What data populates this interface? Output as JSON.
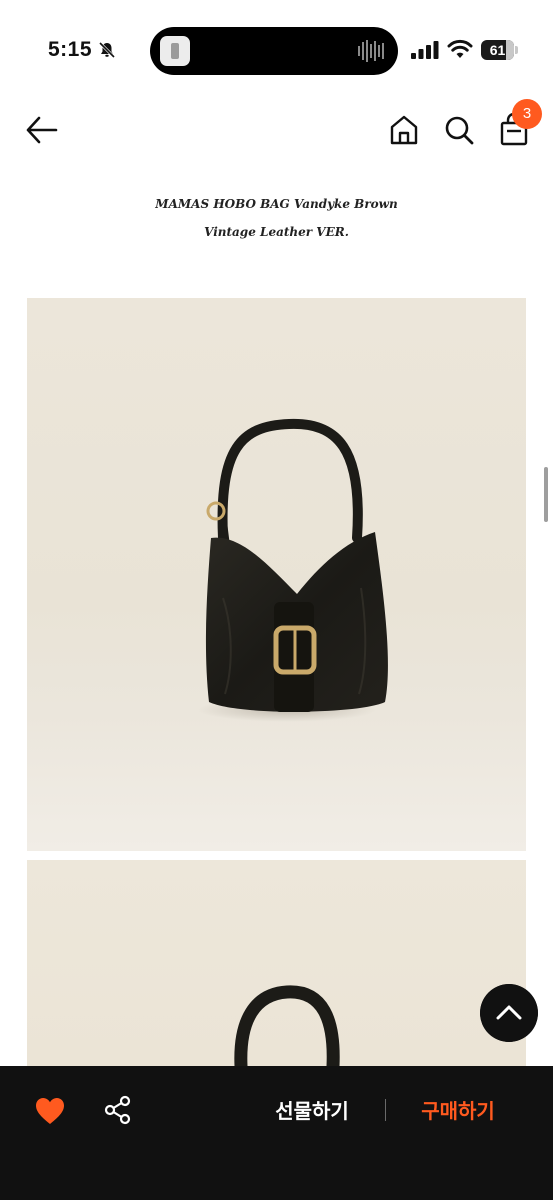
{
  "status_bar": {
    "time": "5:15",
    "battery_level": "61",
    "icons": [
      "bell-slash-icon",
      "signal-icon",
      "wifi-icon",
      "battery-icon"
    ]
  },
  "header": {
    "icons": [
      "back-arrow-icon",
      "home-icon",
      "search-icon",
      "shopping-bag-icon"
    ],
    "cart_count": "3"
  },
  "product": {
    "title_line1": "MAMAS HOBO BAG  Vandyke Brown",
    "title_line2": "Vintage Leather VER."
  },
  "bottom_bar": {
    "gift_label": "선물하기",
    "buy_label": "구매하기",
    "icons": [
      "heart-icon",
      "share-icon"
    ]
  },
  "colors": {
    "accent": "#ff5a1f",
    "bottom_bar_bg": "#111111",
    "image_bg": "#e9e3d6",
    "bag_leather": "#1b1a16",
    "buckle_gold": "#c9a96a"
  }
}
